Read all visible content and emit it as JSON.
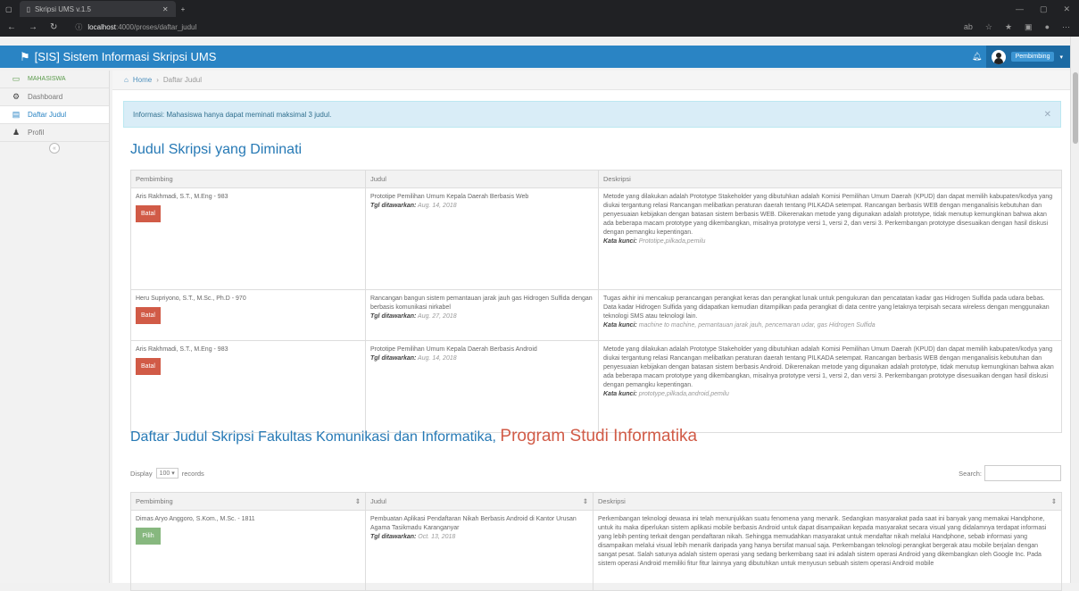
{
  "browser": {
    "tab_title": "Skripsi UMS v.1.5",
    "url_host": "localhost",
    "url_path": ":4000/proses/daftar_judul",
    "ext_label": "ab"
  },
  "app": {
    "brand": "[SIS] Sistem Informasi Skripsi UMS",
    "user_name": "Pembimbing"
  },
  "sidebar": {
    "section": "MAHASISWA",
    "items": [
      {
        "label": "Dashboard",
        "icon": "dashboard-icon"
      },
      {
        "label": "Daftar Judul",
        "icon": "list-icon"
      },
      {
        "label": "Profil",
        "icon": "user-icon"
      }
    ]
  },
  "breadcrumb": {
    "home": "Home",
    "current": "Daftar Judul"
  },
  "alert": {
    "text": "Informasi: Mahasiswa hanya dapat meminati maksimal 3 judul."
  },
  "section1": {
    "title": "Judul Skripsi yang Diminati",
    "headers": [
      "Pembimbing",
      "Judul",
      "Deskripsi"
    ],
    "rows": [
      {
        "pembimbing": "Aris Rakhmadi, S.T., M.Eng - 983",
        "button": "Batal",
        "judul": "Prototipe Pemilihan Umum Kepala Daerah Berbasis Web",
        "date_label": "Tgl ditawarkan:",
        "date": "Aug. 14, 2018",
        "deskripsi": "Metode yang dilakukan adalah Prototype Stakeholder yang dibutuhkan adalah Komisi Pemilihan Umum Daerah (KPUD) dan dapat memilih kabupaten/kodya yang diukai tergantung relasi Rancangan melibatkan peraturan daerah tentang PILKADA setempat. Rancangan berbasis WEB dengan menganalisis kebutuhan dan penyesuaian kebijakan dengan batasan sistem berbasis WEB. Dikerenakan metode yang digunakan adalah prototype, tidak menutup kemungkinan bahwa akan ada beberapa macam prototype yang dikembangkan, misalnya prototype versi 1, versi 2, dan versi 3. Perkembangan prototype disesuaikan dengan hasil diskusi dengan pemangku kepentingan.",
        "kw_label": "Kata kunci:",
        "keywords": "Prototipe,pilkada,pemilu"
      },
      {
        "pembimbing": "Heru Supriyono, S.T., M.Sc., Ph.D - 970",
        "button": "Batal",
        "judul": "Rancangan bangun sistem pemantauan jarak jauh gas Hidrogen Sulfida dengan berbasis komunikasi nirkabel",
        "date_label": "Tgl ditawarkan:",
        "date": "Aug. 27, 2018",
        "deskripsi": "Tugas akhir ini mencakup perancangan perangkat keras dan perangkat lunak untuk pengukuran dan pencatatan kadar gas Hidrogen Sulfida pada udara bebas. Data kadar Hidrogen Sulfida yang didapatkan kemudian ditampilkan pada perangkat di data centre yang letaknya terpisah secara wireless dengan menggunakan teknologi SMS atau teknologi lain.",
        "kw_label": "Kata kunci:",
        "keywords": "machine to machine, pemantauan jarak jauh, pencemaran udar, gas Hidrogen Sulfida"
      },
      {
        "pembimbing": "Aris Rakhmadi, S.T., M.Eng - 983",
        "button": "Batal",
        "judul": "Prototipe Pemilihan Umum Kepala Daerah Berbasis Android",
        "date_label": "Tgl ditawarkan:",
        "date": "Aug. 14, 2018",
        "deskripsi": "Metode yang dilakukan adalah Prototype Stakeholder yang dibutuhkan adalah Komisi Pemilihan Umum Daerah (KPUD) dan dapat memilih kabupaten/kodya yang diukai tergantung relasi Rancangan melibatkan peraturan daerah tentang PILKADA setempat. Rancangan berbasis WEB dengan menganalisis kebutuhan dan penyesuaian kebijakan dengan batasan sistem berbasis Android. Dikerenakan metode yang digunakan adalah prototype, tidak menutup kemungkinan bahwa akan ada beberapa macam prototype yang dikembangkan, misalnya prototype versi 1, versi 2, dan versi 3. Perkembangan prototype disesuaikan dengan hasil diskusi dengan pemangku kepentingan.",
        "kw_label": "Kata kunci:",
        "keywords": "prototype,pilkada,android,pemilu"
      }
    ]
  },
  "section2": {
    "title": "Daftar Judul Skripsi Fakultas Komunikasi dan Informatika,",
    "program": "Program Studi Informatika",
    "display_label": "Display",
    "display_value": "100",
    "records_label": "records",
    "search_label": "Search:",
    "headers": [
      "Pembimbing",
      "Judul",
      "Deskripsi"
    ],
    "rows": [
      {
        "pembimbing": "Dimas Aryo Anggoro, S.Kom., M.Sc. - 1811",
        "button": "Pilih",
        "judul": "Pembuatan Aplikasi Pendaftaran Nikah Berbasis Android di Kantor Urusan Agama Tasikmadu Karanganyar",
        "date_label": "Tgl ditawarkan:",
        "date": "Oct. 13, 2018",
        "deskripsi": "Perkembangan teknologi dewasa ini telah menunjukkan suatu fenomena yang menarik. Sedangkan masyarakat pada saat ini banyak yang memakai Handphone, untuk itu maka diperlukan sistem aplikasi mobile berbasis Android untuk dapat disampaikan kepada masyarakat secara visual yang didalamnya terdapat informasi yang lebih penting terkait dengan pendaftaran nikah. Sehingga memudahkan masyarakat untuk mendaftar nikah melalui Handphone, sebab informasi yang disampaikan melalui visual lebih menarik daripada yang hanya bersifat manual saja. Perkembangan teknologi perangkat bergerak atau mobile berjalan dengan sangat pesat. Salah satunya adalah sistem operasi yang sedang berkembang saat ini adalah sistem operasi Android yang dikembangkan oleh Google Inc. Pada sistem operasi Android memiliki fitur fitur lainnya yang dibutuhkan untuk menyusun sebuah sistem operasi Android mobile"
      }
    ]
  }
}
